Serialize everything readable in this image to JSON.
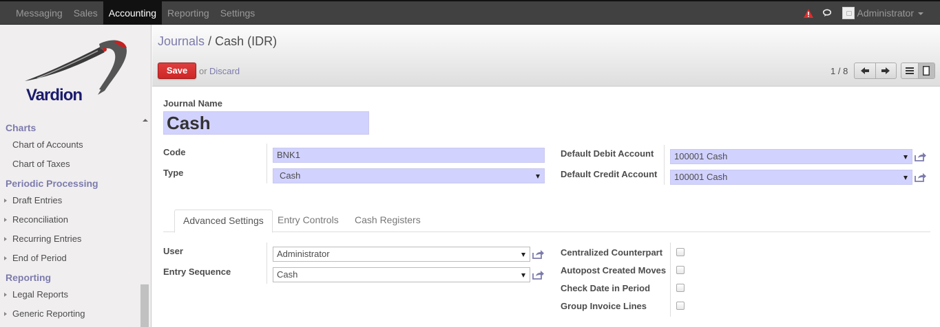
{
  "topbar": {
    "menu": [
      "Messaging",
      "Sales",
      "Accounting",
      "Reporting",
      "Settings"
    ],
    "active_menu": "Accounting",
    "user": "Administrator",
    "icons": [
      "alert-icon",
      "chat-icon",
      "avatar"
    ],
    "alert_color": "#e02d2d"
  },
  "sidebar": {
    "logo_text": "Vardion",
    "sections": [
      {
        "header": "Charts",
        "items": [
          {
            "label": "Chart of Accounts"
          },
          {
            "label": "Chart of Taxes"
          }
        ]
      },
      {
        "header": "Periodic Processing",
        "items": [
          {
            "label": "Draft Entries"
          },
          {
            "label": "Reconciliation"
          },
          {
            "label": "Recurring Entries"
          },
          {
            "label": "End of Period"
          }
        ]
      },
      {
        "header": "Reporting",
        "items": [
          {
            "label": "Legal Reports"
          },
          {
            "label": "Generic Reporting"
          }
        ]
      }
    ]
  },
  "control_panel": {
    "breadcrumb_parent": "Journals",
    "breadcrumb_sep": "/",
    "breadcrumb_current": "Cash (IDR)",
    "save_label": "Save",
    "or_label": "or",
    "discard_label": "Discard",
    "pager": "1 / 8"
  },
  "form": {
    "journal_name_label": "Journal Name",
    "journal_name": "Cash",
    "code_label": "Code",
    "code": "BNK1",
    "type_label": "Type",
    "type": "Cash",
    "debit_label": "Default Debit Account",
    "debit": "100001 Cash",
    "credit_label": "Default Credit Account",
    "credit": "100001 Cash",
    "tabs": [
      "Advanced Settings",
      "Entry Controls",
      "Cash Registers"
    ],
    "active_tab": "Advanced Settings",
    "user_label": "User",
    "user": "Administrator",
    "sequence_label": "Entry Sequence",
    "sequence": "Cash",
    "checks": [
      {
        "label": "Centralized Counterpart",
        "checked": false
      },
      {
        "label": "Autopost Created Moves",
        "checked": false
      },
      {
        "label": "Check Date in Period",
        "checked": false
      },
      {
        "label": "Group Invoice Lines",
        "checked": false
      }
    ]
  },
  "colors": {
    "accent": "#7c7bad",
    "required_field": "#d2d2ff",
    "save_button": "#d33030",
    "topbar": "#414141"
  }
}
